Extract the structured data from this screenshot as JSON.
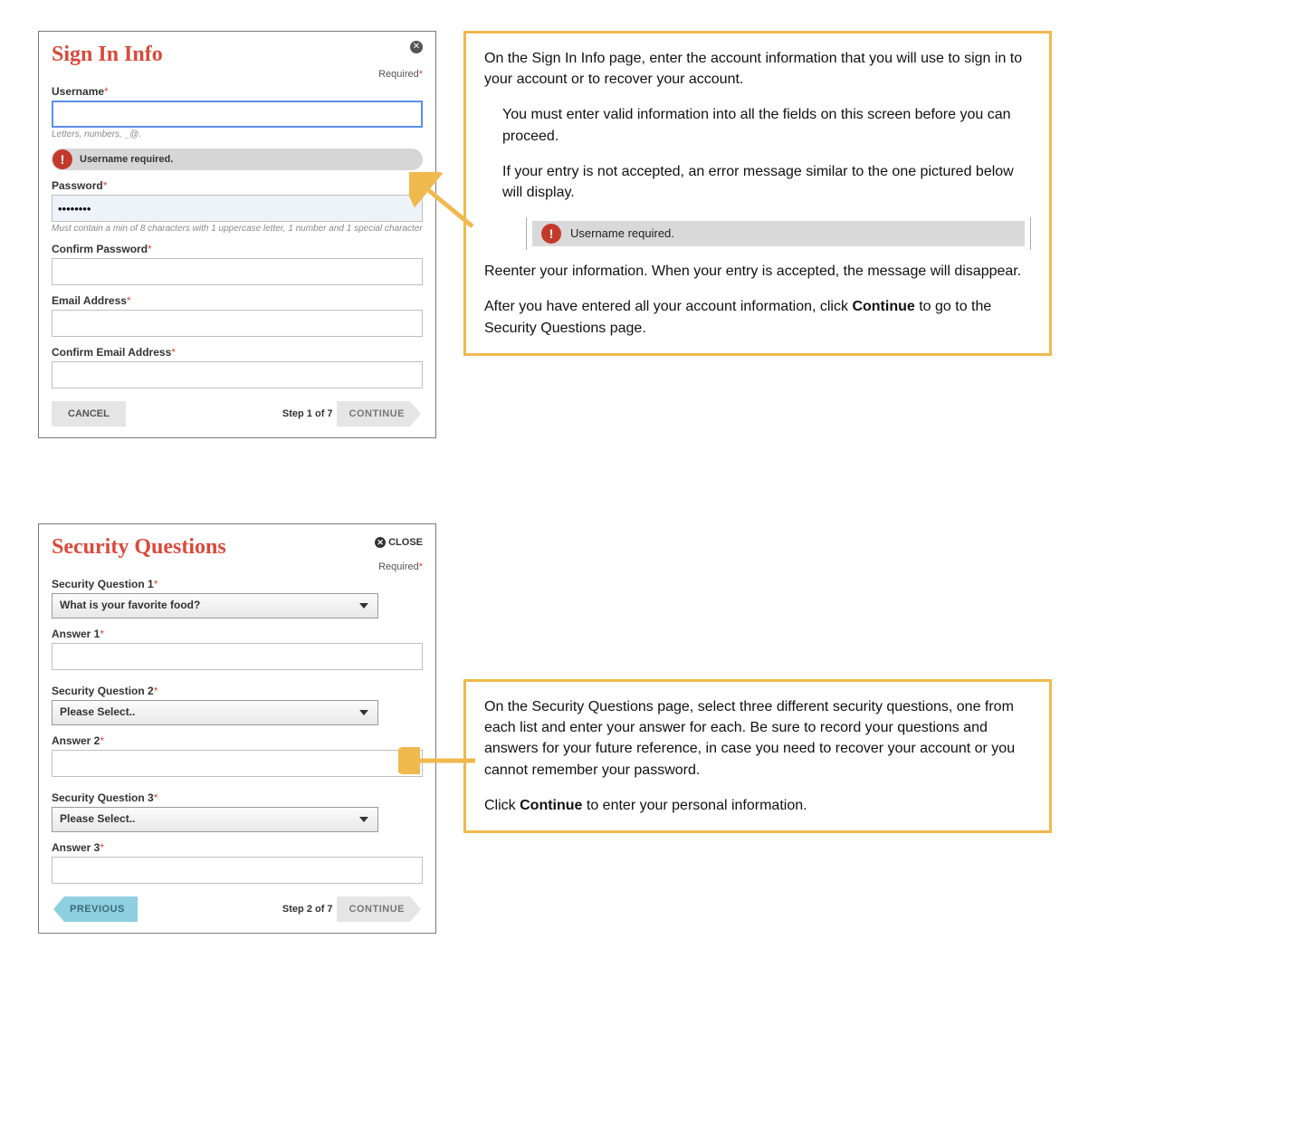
{
  "signin": {
    "title": "Sign In Info",
    "required_label": "Required",
    "close_symbol": "✕",
    "fields": {
      "username_label": "Username",
      "username_hint": "Letters, numbers, _@.",
      "username_error": "Username required.",
      "password_label": "Password",
      "password_value": "••••••••",
      "password_hint": "Must contain a min of 8 characters with 1 uppercase letter, 1 number and 1 special character",
      "confirm_password_label": "Confirm Password",
      "email_label": "Email Address",
      "confirm_email_label": "Confirm Email Address"
    },
    "cancel_label": "CANCEL",
    "step_label": "Step 1 of 7",
    "continue_label": "CONTINUE"
  },
  "sq": {
    "title": "Security Questions",
    "close_label": "CLOSE",
    "required_label": "Required",
    "q1_label": "Security Question 1",
    "q1_selected": "What is your favorite food?",
    "a1_label": "Answer 1",
    "q2_label": "Security Question 2",
    "q2_selected": "Please Select..",
    "a2_label": "Answer 2",
    "q3_label": "Security Question 3",
    "q3_selected": "Please Select..",
    "a3_label": "Answer 3",
    "previous_label": "PREVIOUS",
    "step_label": "Step 2 of 7",
    "continue_label": "CONTINUE"
  },
  "callout1": {
    "p1": "On the Sign In Info page, enter the account information that you will use to sign in to your account or to recover your account.",
    "p2": "You must enter valid information into all the fields on this screen before you can proceed.",
    "p3": "If your entry is not accepted, an error message similar to the one pictured below will display.",
    "demo_error": "Username required.",
    "p4": "Reenter your information. When your entry is accepted, the message will disappear.",
    "p5a": "After you have entered all your account information, click ",
    "p5b": "Continue",
    "p5c": " to go to the Security Questions page."
  },
  "callout2": {
    "p1": "On the Security Questions page, select three different security questions, one from each list and enter your answer for each. Be sure to record your questions and answers for your future reference, in case you need to recover your account or you cannot remember your password.",
    "p2a": "Click ",
    "p2b": "Continue",
    "p2c": " to enter your personal information."
  }
}
